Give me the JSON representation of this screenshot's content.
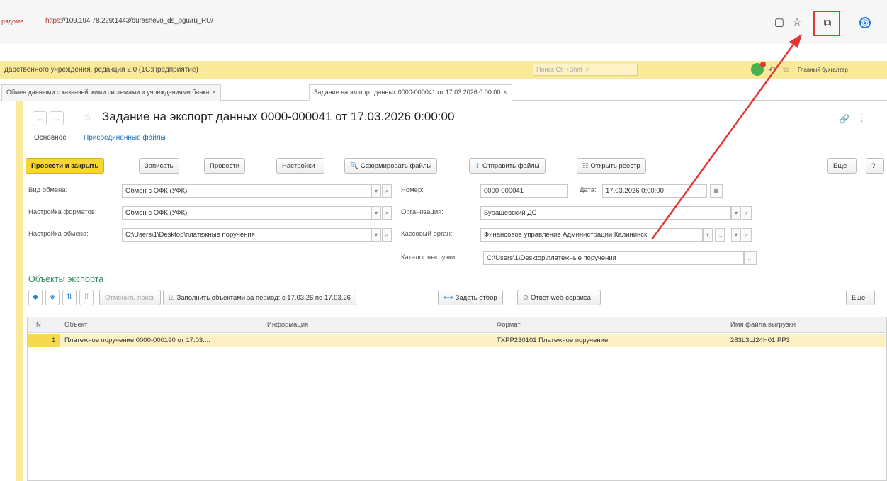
{
  "browser": {
    "url_prefix": "рядоме",
    "url_proto": "https",
    "url_rest": "://109.194.78.229:1443/burashevo_ds_bgu/ru_RU/"
  },
  "app": {
    "title": "дарственного учреждения, редакция 2.0  (1С:Предприятие)",
    "search_placeholder": "Поиск Ctrl+Shift+F",
    "user": "Главный бухгалтер"
  },
  "tabs": [
    {
      "label": "Обмен данными с казначейскими системами и учреждениями банка",
      "close": "×"
    },
    {
      "label": "Задание на экспорт данных 0000-000041 от 17.03.2026 0:00:00",
      "close": "×"
    }
  ],
  "document": {
    "title": "Задание на экспорт данных 0000-000041 от 17.03.2026 0:00:00",
    "subtab_main": "Основное",
    "subtab_files": "Присоединенные файлы"
  },
  "toolbar": {
    "post_close": "Провести и закрыть",
    "save": "Записать",
    "post": "Провести",
    "settings": "Настройки -",
    "form_files": "Сформировать файлы",
    "send_files": "Отправить файлы",
    "open_registry": "Открыть реестр",
    "more": "Еще -",
    "help": "?"
  },
  "form": {
    "exchange_type_label": "Вид обмена:",
    "exchange_type_value": "Обмен с ОФК (УФК)",
    "format_settings_label": "Настройка форматов:",
    "format_settings_value": "Обмен с ОФК (УФК)",
    "exchange_settings_label": "Настройка обмена:",
    "exchange_settings_value": "C:\\Users\\1\\Desktop\\платежные поручения",
    "number_label": "Номер:",
    "number_value": "0000-000041",
    "date_label": "Дата:",
    "date_value": "17.03.2026  0:00:00",
    "org_label": "Организация:",
    "org_value": "Бурашевский ДС",
    "cash_label": "Кассовый орган:",
    "cash_value": "Финансовое управление Администрации Калининск",
    "catalog_label": "Каталог выгрузки:",
    "catalog_value": "C:\\Users\\1\\Desktop\\платежные поручения"
  },
  "objects": {
    "section_title": "Объекты экспорта",
    "cancel_search": "Отменить поиск",
    "fill_period": "Заполнить объектами за период: с 17.03.26 по 17.03.26",
    "set_filter": "Задать отбор",
    "web_answer": "Ответ web-сервиса -",
    "more": "Еще -",
    "columns": [
      "N",
      "Объект",
      "Информация",
      "Формат",
      "Имя файла выгрузки"
    ],
    "rows": [
      {
        "n": "1",
        "object": "Платежное поручение 0000-000190 от 17.03....",
        "info": "",
        "format": "TXPP230101 Платежное поручение",
        "file": "283L3Щ24Н01.PP3"
      }
    ]
  },
  "colors": {
    "accent_yellow": "#f7d634",
    "highlight_red": "#e23636",
    "section_green": "#2e8b57"
  }
}
